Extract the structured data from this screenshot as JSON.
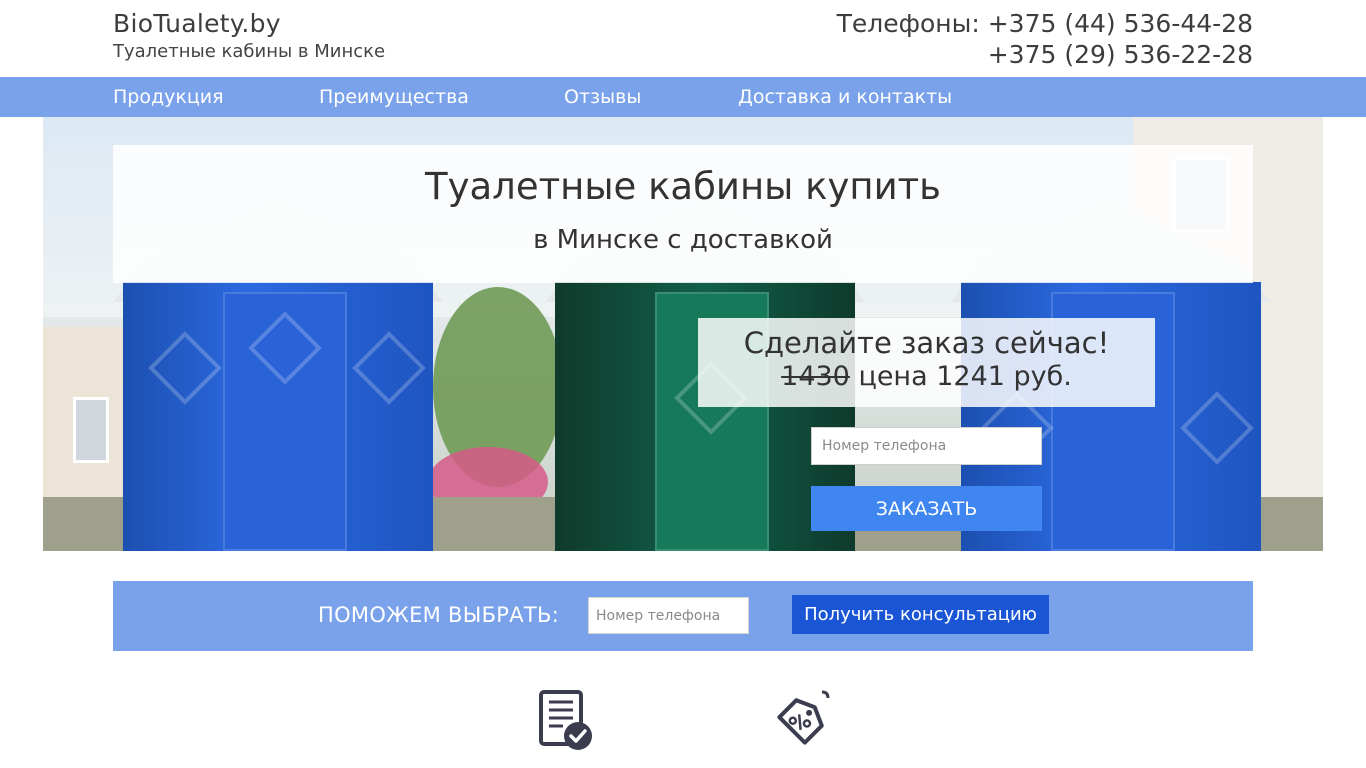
{
  "header": {
    "site_name": "BioTualety.by",
    "tagline": "Туалетные кабины в Минске",
    "phones_prefix": "Телефоны: ",
    "phone_1": "+375 (44) 536-44-28",
    "phone_2": "+375 (29) 536-22-28"
  },
  "nav": {
    "items": [
      {
        "label": "Продукция"
      },
      {
        "label": "Преимущества"
      },
      {
        "label": "Отзывы"
      },
      {
        "label": "Доставка и контакты"
      }
    ]
  },
  "hero": {
    "title": "Туалетные кабины купить",
    "subtitle": "в Минске с доставкой",
    "order_title": "Сделайте заказ сейчас!",
    "old_price": "1430",
    "price_text": " цена 1241 руб.",
    "phone_placeholder": "Номер телефона",
    "order_button": "ЗАКАЗАТЬ"
  },
  "consult": {
    "label": "ПОМОЖЕМ ВЫБРАТЬ:",
    "phone_placeholder": "Номер телефона",
    "button": "Получить консультацию"
  },
  "features": {
    "icons": [
      "document-check-icon",
      "discount-tag-icon"
    ]
  },
  "colors": {
    "nav_bg": "#79a2ea",
    "order_button": "#3f86f0",
    "consult_button": "#1a55d6"
  }
}
